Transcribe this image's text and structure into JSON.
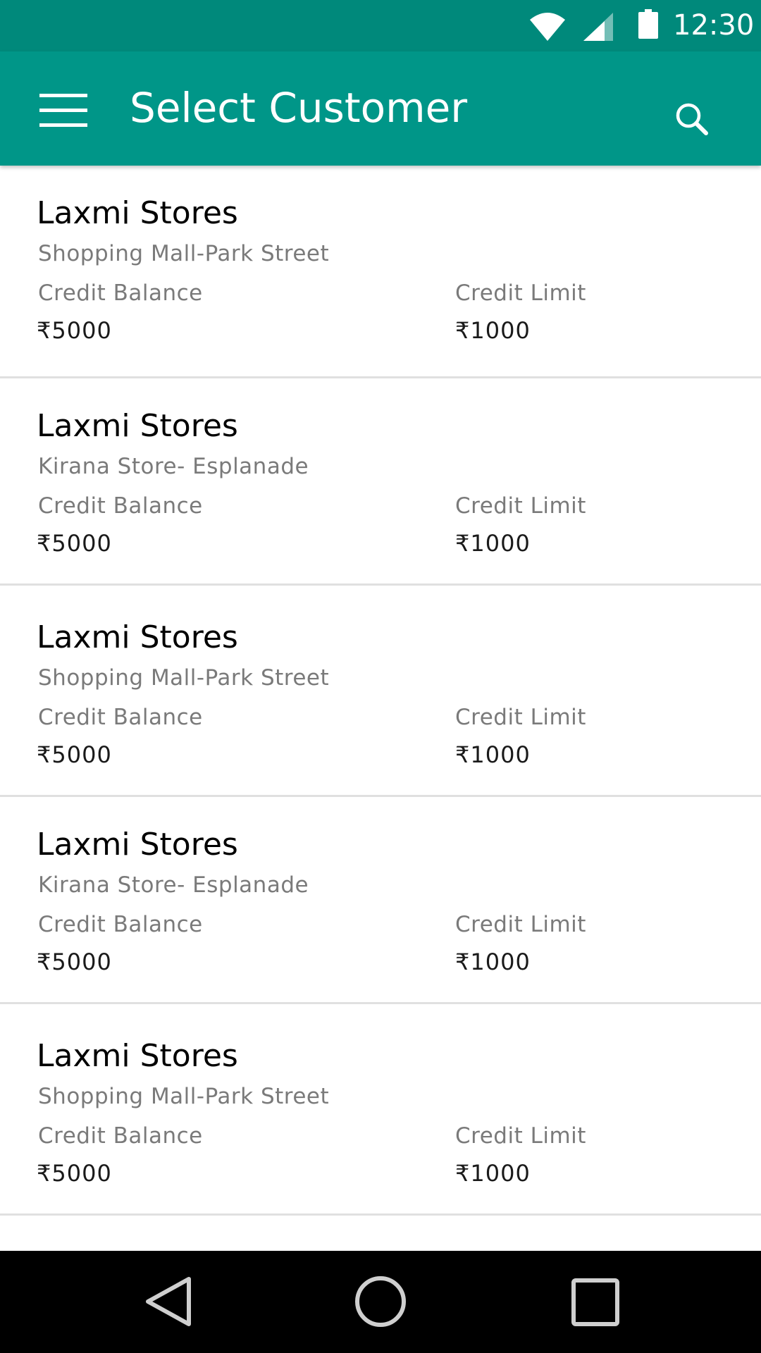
{
  "status_bar": {
    "time": "12:30",
    "icons": [
      "wifi-icon",
      "cell-signal-icon",
      "battery-icon"
    ]
  },
  "app_bar": {
    "title": "Select Customer",
    "menu_icon": "hamburger-menu-icon",
    "search_icon": "search-icon"
  },
  "customers": [
    {
      "name": "Laxmi Stores",
      "location": "Shopping Mall-Park Street",
      "credit_balance_label": "Credit Balance",
      "credit_balance": "₹5000",
      "credit_limit_label": "Credit Limit",
      "credit_limit": "₹1000"
    },
    {
      "name": "Laxmi Stores",
      "location": "Kirana Store- Esplanade",
      "credit_balance_label": "Credit Balance",
      "credit_balance": "₹5000",
      "credit_limit_label": "Credit Limit",
      "credit_limit": "₹1000"
    },
    {
      "name": "Laxmi Stores",
      "location": "Shopping Mall-Park Street",
      "credit_balance_label": "Credit Balance",
      "credit_balance": "₹5000",
      "credit_limit_label": "Credit Limit",
      "credit_limit": "₹1000"
    },
    {
      "name": "Laxmi Stores",
      "location": "Kirana Store- Esplanade",
      "credit_balance_label": "Credit Balance",
      "credit_balance": "₹5000",
      "credit_limit_label": "Credit Limit",
      "credit_limit": "₹1000"
    },
    {
      "name": "Laxmi Stores",
      "location": "Shopping Mall-Park Street",
      "credit_balance_label": "Credit Balance",
      "credit_balance": "₹5000",
      "credit_limit_label": "Credit Limit",
      "credit_limit": "₹1000"
    }
  ],
  "nav_bar": {
    "icons": [
      "back-icon",
      "home-icon",
      "recent-apps-icon"
    ]
  },
  "colors": {
    "status_bar": "#00897b",
    "app_bar": "#009688",
    "title_text": "#ffffff",
    "secondary_text": "#7a7a7a",
    "divider": "#e0e0e0",
    "nav_bar": "#000000"
  }
}
